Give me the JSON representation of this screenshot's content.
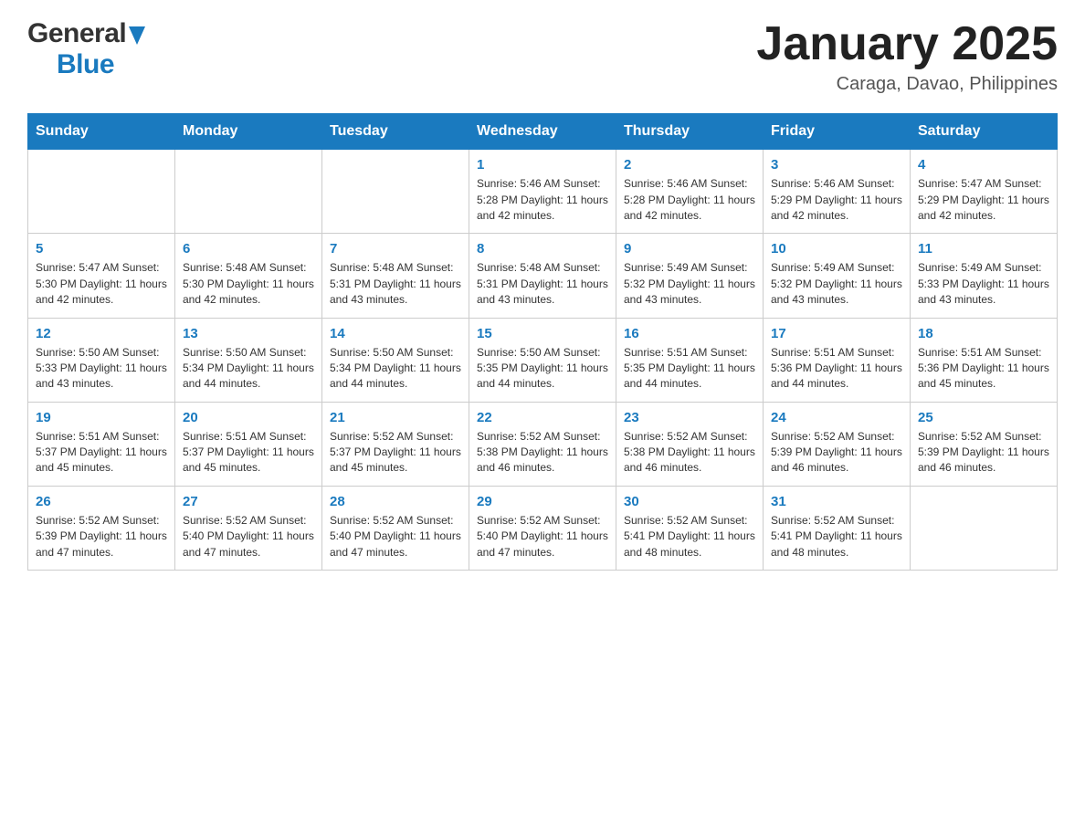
{
  "header": {
    "logo_general": "General",
    "logo_blue": "Blue",
    "month_year": "January 2025",
    "location": "Caraga, Davao, Philippines"
  },
  "calendar": {
    "days_of_week": [
      "Sunday",
      "Monday",
      "Tuesday",
      "Wednesday",
      "Thursday",
      "Friday",
      "Saturday"
    ],
    "weeks": [
      {
        "days": [
          {
            "num": "",
            "info": ""
          },
          {
            "num": "",
            "info": ""
          },
          {
            "num": "",
            "info": ""
          },
          {
            "num": "1",
            "info": "Sunrise: 5:46 AM\nSunset: 5:28 PM\nDaylight: 11 hours and 42 minutes."
          },
          {
            "num": "2",
            "info": "Sunrise: 5:46 AM\nSunset: 5:28 PM\nDaylight: 11 hours and 42 minutes."
          },
          {
            "num": "3",
            "info": "Sunrise: 5:46 AM\nSunset: 5:29 PM\nDaylight: 11 hours and 42 minutes."
          },
          {
            "num": "4",
            "info": "Sunrise: 5:47 AM\nSunset: 5:29 PM\nDaylight: 11 hours and 42 minutes."
          }
        ]
      },
      {
        "days": [
          {
            "num": "5",
            "info": "Sunrise: 5:47 AM\nSunset: 5:30 PM\nDaylight: 11 hours and 42 minutes."
          },
          {
            "num": "6",
            "info": "Sunrise: 5:48 AM\nSunset: 5:30 PM\nDaylight: 11 hours and 42 minutes."
          },
          {
            "num": "7",
            "info": "Sunrise: 5:48 AM\nSunset: 5:31 PM\nDaylight: 11 hours and 43 minutes."
          },
          {
            "num": "8",
            "info": "Sunrise: 5:48 AM\nSunset: 5:31 PM\nDaylight: 11 hours and 43 minutes."
          },
          {
            "num": "9",
            "info": "Sunrise: 5:49 AM\nSunset: 5:32 PM\nDaylight: 11 hours and 43 minutes."
          },
          {
            "num": "10",
            "info": "Sunrise: 5:49 AM\nSunset: 5:32 PM\nDaylight: 11 hours and 43 minutes."
          },
          {
            "num": "11",
            "info": "Sunrise: 5:49 AM\nSunset: 5:33 PM\nDaylight: 11 hours and 43 minutes."
          }
        ]
      },
      {
        "days": [
          {
            "num": "12",
            "info": "Sunrise: 5:50 AM\nSunset: 5:33 PM\nDaylight: 11 hours and 43 minutes."
          },
          {
            "num": "13",
            "info": "Sunrise: 5:50 AM\nSunset: 5:34 PM\nDaylight: 11 hours and 44 minutes."
          },
          {
            "num": "14",
            "info": "Sunrise: 5:50 AM\nSunset: 5:34 PM\nDaylight: 11 hours and 44 minutes."
          },
          {
            "num": "15",
            "info": "Sunrise: 5:50 AM\nSunset: 5:35 PM\nDaylight: 11 hours and 44 minutes."
          },
          {
            "num": "16",
            "info": "Sunrise: 5:51 AM\nSunset: 5:35 PM\nDaylight: 11 hours and 44 minutes."
          },
          {
            "num": "17",
            "info": "Sunrise: 5:51 AM\nSunset: 5:36 PM\nDaylight: 11 hours and 44 minutes."
          },
          {
            "num": "18",
            "info": "Sunrise: 5:51 AM\nSunset: 5:36 PM\nDaylight: 11 hours and 45 minutes."
          }
        ]
      },
      {
        "days": [
          {
            "num": "19",
            "info": "Sunrise: 5:51 AM\nSunset: 5:37 PM\nDaylight: 11 hours and 45 minutes."
          },
          {
            "num": "20",
            "info": "Sunrise: 5:51 AM\nSunset: 5:37 PM\nDaylight: 11 hours and 45 minutes."
          },
          {
            "num": "21",
            "info": "Sunrise: 5:52 AM\nSunset: 5:37 PM\nDaylight: 11 hours and 45 minutes."
          },
          {
            "num": "22",
            "info": "Sunrise: 5:52 AM\nSunset: 5:38 PM\nDaylight: 11 hours and 46 minutes."
          },
          {
            "num": "23",
            "info": "Sunrise: 5:52 AM\nSunset: 5:38 PM\nDaylight: 11 hours and 46 minutes."
          },
          {
            "num": "24",
            "info": "Sunrise: 5:52 AM\nSunset: 5:39 PM\nDaylight: 11 hours and 46 minutes."
          },
          {
            "num": "25",
            "info": "Sunrise: 5:52 AM\nSunset: 5:39 PM\nDaylight: 11 hours and 46 minutes."
          }
        ]
      },
      {
        "days": [
          {
            "num": "26",
            "info": "Sunrise: 5:52 AM\nSunset: 5:39 PM\nDaylight: 11 hours and 47 minutes."
          },
          {
            "num": "27",
            "info": "Sunrise: 5:52 AM\nSunset: 5:40 PM\nDaylight: 11 hours and 47 minutes."
          },
          {
            "num": "28",
            "info": "Sunrise: 5:52 AM\nSunset: 5:40 PM\nDaylight: 11 hours and 47 minutes."
          },
          {
            "num": "29",
            "info": "Sunrise: 5:52 AM\nSunset: 5:40 PM\nDaylight: 11 hours and 47 minutes."
          },
          {
            "num": "30",
            "info": "Sunrise: 5:52 AM\nSunset: 5:41 PM\nDaylight: 11 hours and 48 minutes."
          },
          {
            "num": "31",
            "info": "Sunrise: 5:52 AM\nSunset: 5:41 PM\nDaylight: 11 hours and 48 minutes."
          },
          {
            "num": "",
            "info": ""
          }
        ]
      }
    ]
  }
}
